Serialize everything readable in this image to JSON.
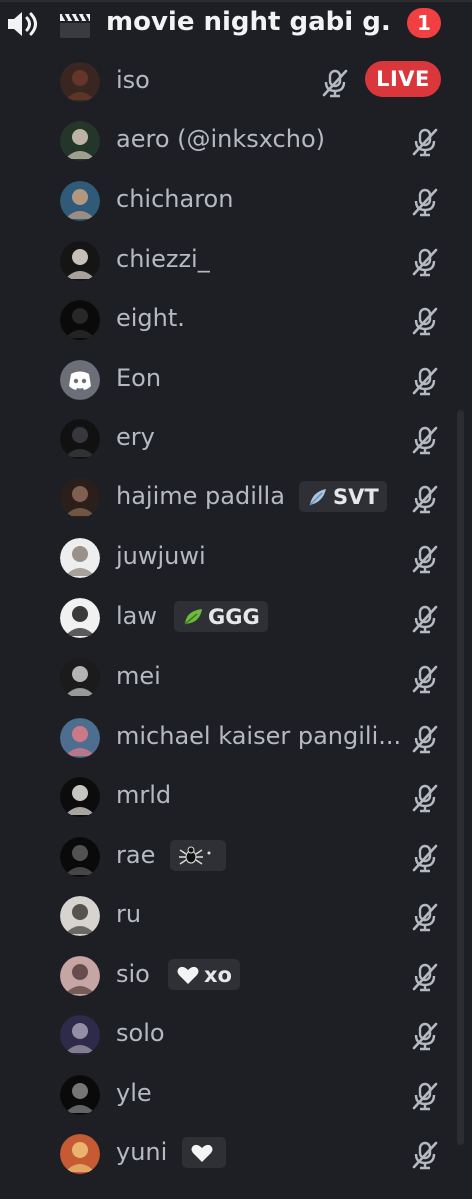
{
  "channel": {
    "name": "movie night gabi g...",
    "mention_count": "1"
  },
  "members": [
    {
      "name": "iso",
      "live": "LIVE"
    },
    {
      "name": "aero (@inksxcho)"
    },
    {
      "name": "chicharon"
    },
    {
      "name": "chiezzi_"
    },
    {
      "name": "eight."
    },
    {
      "name": "Eon"
    },
    {
      "name": "ery"
    },
    {
      "name": "hajime padilla",
      "tag": "SVT",
      "tag_icon": "blue-feather-icon"
    },
    {
      "name": "juwjuwi"
    },
    {
      "name": "law",
      "tag": "GGG",
      "tag_icon": "green-leaf-icon"
    },
    {
      "name": "mei"
    },
    {
      "name": "michael kaiser pangili..."
    },
    {
      "name": "mrld"
    },
    {
      "name": "rae",
      "tag": "",
      "tag_icon": "spider-icon"
    },
    {
      "name": "ru"
    },
    {
      "name": "sio",
      "tag": "xo",
      "tag_icon": "white-heart-icon"
    },
    {
      "name": "solo"
    },
    {
      "name": "yle"
    },
    {
      "name": "yuni",
      "tag": "",
      "tag_icon": "white-heart-icon"
    }
  ],
  "colors": {
    "background": "#1e1f24",
    "live": "#da373c",
    "mention": "#f23f42",
    "member_text": "#b5bac1",
    "discord_blurple_default_avatar": "#5865f2"
  }
}
